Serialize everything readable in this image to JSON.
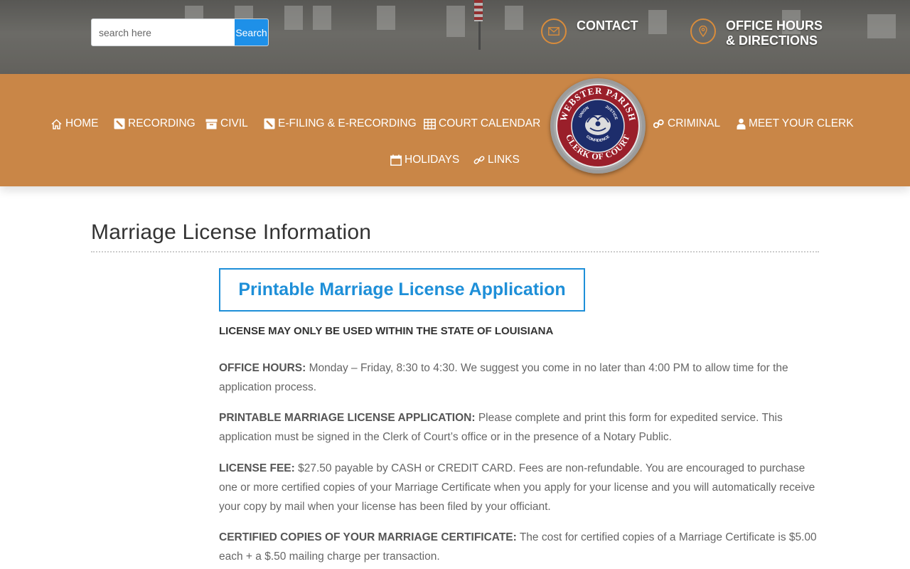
{
  "header": {
    "search": {
      "placeholder": "search here",
      "button_label": "Search"
    },
    "contact_label": "CONTACT",
    "hours_label_line1": "OFFICE HOURS",
    "hours_label_line2": "& DIRECTIONS"
  },
  "nav": {
    "items": [
      {
        "label": "HOME",
        "icon": "home-icon"
      },
      {
        "label": "RECORDING",
        "icon": "pencil-square-icon"
      },
      {
        "label": "CIVIL",
        "icon": "archive-box-icon"
      },
      {
        "label": "E-FILING & E-RECORDING",
        "icon": "pencil-square-icon"
      },
      {
        "label": "COURT CALENDAR",
        "icon": "table-grid-icon"
      },
      {
        "label": "CRIMINAL",
        "icon": "handcuffs-icon"
      },
      {
        "label": "MEET YOUR CLERK",
        "icon": "user-icon"
      },
      {
        "label": "HOLIDAYS",
        "icon": "calendar-icon"
      },
      {
        "label": "LINKS",
        "icon": "link-icon"
      }
    ],
    "seal": {
      "top_text": "WEBSTER PARISH",
      "bottom_text": "CLERK OF COURT",
      "motto_union": "UNION",
      "motto_justice": "JUSTICE",
      "motto_confidence": "CONFIDENCE"
    }
  },
  "main": {
    "title": "Marriage License Information",
    "app_button_label": "Printable Marriage License Application",
    "notice": "LICENSE MAY ONLY BE USED WITHIN THE STATE OF LOUISIANA",
    "sections": [
      {
        "heading": "OFFICE HOURS:",
        "text": " Monday – Friday, 8:30 to 4:30. We suggest you come in no later than 4:00 PM to allow time for the application process."
      },
      {
        "heading": "PRINTABLE MARRIAGE LICENSE APPLICATION:",
        "text": " Please complete and print this form for expedited service. This application must be signed in the Clerk of Court’s office or in the presence of a Notary Public."
      },
      {
        "heading": "LICENSE FEE:",
        "text": " $27.50 payable by CASH or CREDIT CARD.   Fees are non-refundable.   You are encouraged to purchase one or more certified copies of your Marriage Certificate when you apply for your license and you will automatically receive your copy by mail when your license has been filed by your officiant."
      },
      {
        "heading": "CERTIFIED COPIES OF YOUR MARRIAGE CERTIFICATE:",
        "text": "  The cost for certified copies of a Marriage Certificate is $5.00 each + a $.50 mailing charge per transaction."
      }
    ]
  },
  "colors": {
    "nav_bg": "#c98647",
    "accent_blue": "#1e8fd8",
    "icon_ring": "#d98c3b"
  }
}
